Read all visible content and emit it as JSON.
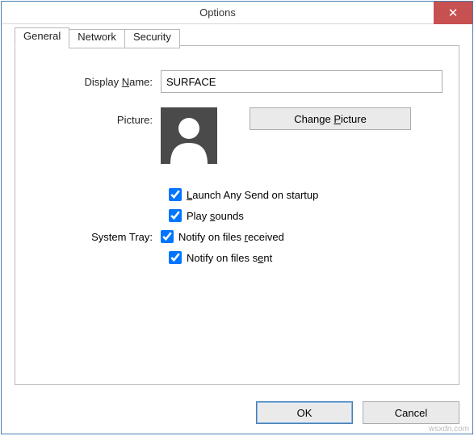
{
  "window": {
    "title": "Options"
  },
  "tabs": {
    "general": "General",
    "network": "Network",
    "security": "Security"
  },
  "general": {
    "displayName_label_pre": "Display ",
    "displayName_label_u": "N",
    "displayName_label_post": "ame:",
    "displayName_value": "SURFACE",
    "picture_label": "Picture:",
    "changePicture_pre": "Change ",
    "changePicture_u": "P",
    "changePicture_post": "icture",
    "launch_u": "L",
    "launch_post": "aunch Any Send on startup",
    "launch_checked": true,
    "play_pre": "Play ",
    "play_u": "s",
    "play_post": "ounds",
    "play_checked": true,
    "systray_label": "System Tray:",
    "notify_recv_pre": "Notify on files ",
    "notify_recv_u": "r",
    "notify_recv_post": "eceived",
    "notify_recv_checked": true,
    "notify_sent_pre": "Notify on files s",
    "notify_sent_u": "e",
    "notify_sent_post": "nt",
    "notify_sent_checked": true
  },
  "buttons": {
    "ok": "OK",
    "cancel": "Cancel"
  },
  "watermark": "wsxdn.com"
}
